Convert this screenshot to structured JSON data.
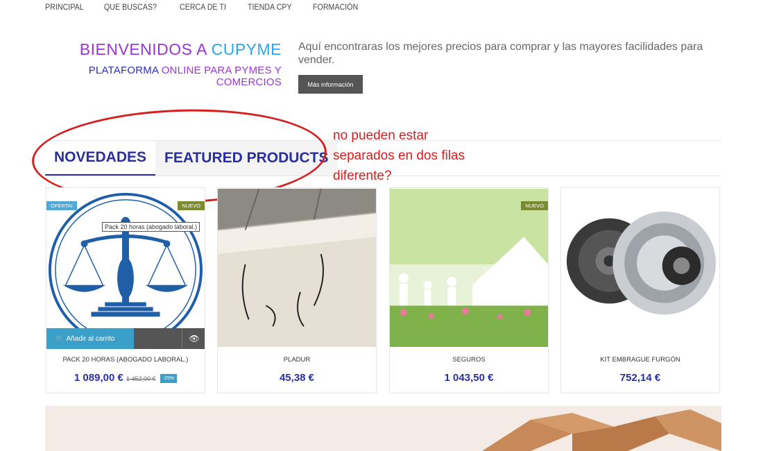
{
  "nav": [
    "PRINCIPAL",
    "QUE BUSCAS?",
    "CERCA DE TI",
    "TIENDA CPY",
    "FORMACIÓN"
  ],
  "welcome": {
    "title_pre": "BIENVENIDOS A ",
    "title_hl": "CUPYME",
    "subtitle_pre": "PLATAFORMA ",
    "subtitle_hl": "ONLINE PARA PYMES Y COMERCIOS"
  },
  "intro": {
    "text": "Aquí encontraras los mejores precios para comprar y las mayores facilidades para vender.",
    "button": "Más información"
  },
  "tabs": [
    "NOVEDADES",
    "FEATURED PRODUCTS"
  ],
  "annotation": [
    "no pueden estar",
    "separados en dos filas",
    "diferente?"
  ],
  "products": [
    {
      "name": "PACK 20 HORAS (ABOGADO LABORAL.)",
      "price": "1 089,00 €",
      "old_price": "1 452,00 €",
      "discount": "-25%",
      "badge_left": "OFERTA!",
      "badge_right": "NUEVO",
      "tooltip": "Pack 20 horas  (abogado laboral.)",
      "cart": "Añadir al carrito"
    },
    {
      "name": "PLADUR",
      "price": "45,38 €"
    },
    {
      "name": "SEGUROS",
      "price": "1 043,50 €",
      "badge_right": "NUEVO"
    },
    {
      "name": "KIT EMBRAGUE FURGÓN",
      "price": "752,14 €"
    }
  ],
  "colors": {
    "brand_purple": "#9a35d6",
    "brand_blue": "#2a2fa0",
    "accent": "#3a9fc9",
    "annotation_red": "#d42020"
  }
}
